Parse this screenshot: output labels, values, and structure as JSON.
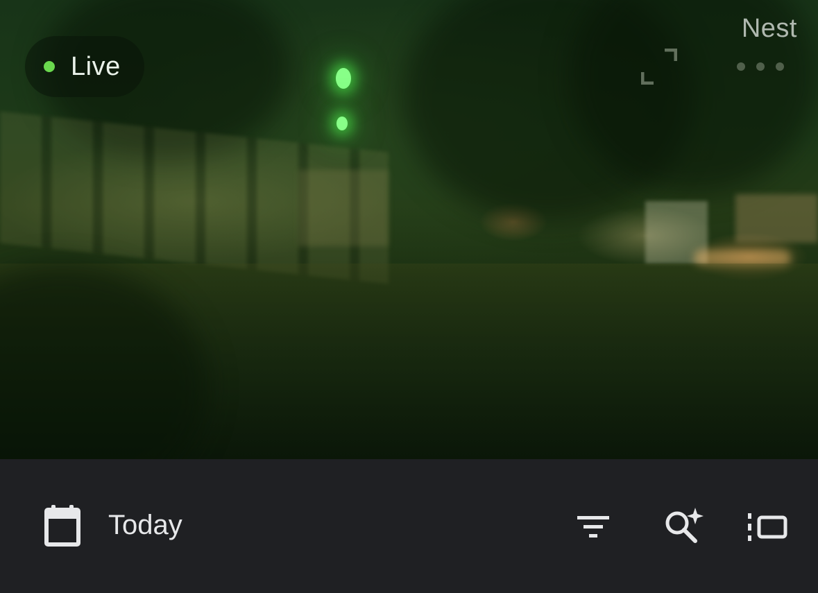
{
  "feed": {
    "status_label": "Live",
    "status_color": "#6ad94e",
    "brand": "Nest",
    "icons": [
      "fullscreen-icon",
      "more-icon"
    ]
  },
  "toolbar": {
    "date_label": "Today",
    "icons": [
      "calendar-icon",
      "filter-icon",
      "smart-search-icon",
      "view-toggle-icon"
    ]
  },
  "colors": {
    "toolbar_bg": "#1f2023",
    "text": "#e7e8ea"
  }
}
